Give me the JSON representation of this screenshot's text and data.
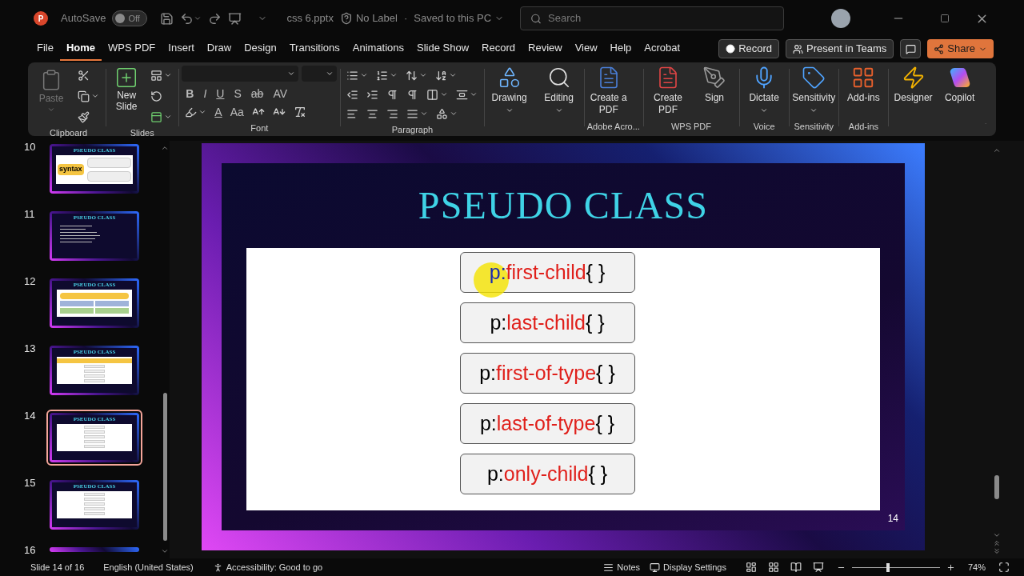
{
  "titlebar": {
    "logo_letter": "P",
    "autosave_label": "AutoSave",
    "autosave_on": false,
    "autosave_state": "Off",
    "filename": "css 6.pptx",
    "label": "No Label",
    "separator": "·",
    "save_status": "Saved to this PC",
    "search_placeholder": "Search"
  },
  "menu_tabs": [
    {
      "label": "File",
      "selected": false
    },
    {
      "label": "Home",
      "selected": true
    },
    {
      "label": "WPS PDF",
      "selected": false
    },
    {
      "label": "Insert",
      "selected": false
    },
    {
      "label": "Draw",
      "selected": false
    },
    {
      "label": "Design",
      "selected": false
    },
    {
      "label": "Transitions",
      "selected": false
    },
    {
      "label": "Animations",
      "selected": false
    },
    {
      "label": "Slide Show",
      "selected": false
    },
    {
      "label": "Record",
      "selected": false
    },
    {
      "label": "Review",
      "selected": false
    },
    {
      "label": "View",
      "selected": false
    },
    {
      "label": "Help",
      "selected": false
    },
    {
      "label": "Acrobat",
      "selected": false
    }
  ],
  "actions": {
    "record": "Record",
    "teams": "Present in Teams",
    "share": "Share"
  },
  "ribbon": {
    "clipboard": {
      "paste": "Paste",
      "paste_disabled": true,
      "label": "Clipboard"
    },
    "slides": {
      "new_slide": "New Slide",
      "label": "Slides"
    },
    "font": {
      "label": "Font",
      "format_keys": [
        "B",
        "I",
        "U",
        "S",
        "ab",
        "AV"
      ],
      "color_key": "A",
      "case_key": "Aa"
    },
    "paragraph": {
      "label": "Paragraph"
    },
    "big_groups": [
      {
        "buttons": [
          {
            "label": "Drawing",
            "kind": "shapes",
            "dropdown": true
          }
        ]
      },
      {
        "buttons": [
          {
            "label": "Editing",
            "kind": "find",
            "dropdown": true
          }
        ]
      },
      {
        "label": "Adobe Acro...",
        "buttons": [
          {
            "label": "Create a PDF",
            "kind": "acrobat",
            "dropdown": false
          }
        ]
      },
      {
        "label": "WPS PDF",
        "buttons": [
          {
            "label": "Create PDF",
            "kind": "wps",
            "dropdown": false
          },
          {
            "label": "Sign",
            "kind": "sign",
            "dropdown": false
          }
        ]
      },
      {
        "label": "Voice",
        "buttons": [
          {
            "label": "Dictate",
            "kind": "dictate",
            "dropdown": true
          }
        ]
      },
      {
        "label": "Sensitivity",
        "buttons": [
          {
            "label": "Sensitivity",
            "kind": "sensitivity",
            "dropdown": true
          }
        ]
      },
      {
        "label": "Add-ins",
        "buttons": [
          {
            "label": "Add-ins",
            "kind": "addins",
            "dropdown": false
          }
        ]
      },
      {
        "buttons": [
          {
            "label": "Designer",
            "kind": "designer",
            "dropdown": false
          },
          {
            "label": "Copilot",
            "kind": "copilot",
            "dropdown": false
          }
        ]
      }
    ]
  },
  "thumbnails": [
    {
      "number": "10",
      "title": "PSEUDO CLASS",
      "kind": "syntax",
      "badge": "syntax",
      "selected": false
    },
    {
      "number": "11",
      "title": "PSEUDO CLASS",
      "kind": "bullets",
      "selected": false
    },
    {
      "number": "12",
      "title": "PSEUDO CLASS",
      "kind": "grid",
      "selected": false
    },
    {
      "number": "13",
      "title": "PSEUDO CLASS",
      "kind": "banner-list",
      "selected": false
    },
    {
      "number": "14",
      "title": "PSEUDO CLASS",
      "kind": "list",
      "selected": true
    },
    {
      "number": "15",
      "title": "PSEUDO CLASS",
      "kind": "list",
      "selected": false
    },
    {
      "number": "16",
      "kind": "cut",
      "selected": false
    }
  ],
  "slide": {
    "title": "PSEUDO CLASS",
    "number": "14",
    "selectors": [
      {
        "prefix": "p:",
        "name": "first-child",
        "suffix": "{ }",
        "pointer": true
      },
      {
        "prefix": "p:",
        "name": "last-child",
        "suffix": "{ }",
        "pointer": false
      },
      {
        "prefix": "p:",
        "name": "first-of-type",
        "suffix": "{ }",
        "pointer": false
      },
      {
        "prefix": "p:",
        "name": "last-of-type",
        "suffix": "{ }",
        "pointer": false
      },
      {
        "prefix": "p:",
        "name": "only-child",
        "suffix": "{ }",
        "pointer": false
      }
    ]
  },
  "status_bar": {
    "slide": "Slide 14 of 16",
    "language": "English (United States)",
    "accessibility": "Accessibility: Good to go",
    "notes": "Notes",
    "display": "Display Settings",
    "zoom": "74%",
    "level": 0.41
  }
}
